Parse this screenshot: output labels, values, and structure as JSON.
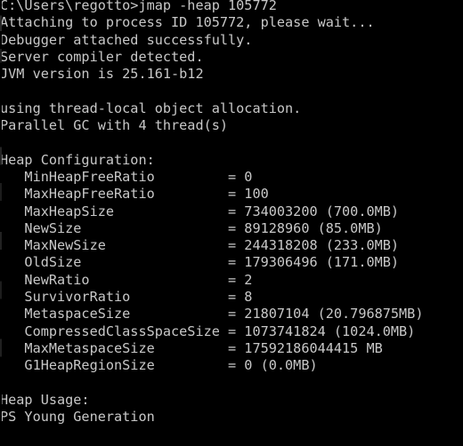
{
  "window": {
    "title": "C:\\WINDOWS\\system32\\cmd.exe",
    "background_color": "#000000",
    "foreground_color": "#c8c8c8"
  },
  "terminal": {
    "prompt": "C:\\Users\\regotto>",
    "command": "jmap -heap 105772",
    "cwd": "C:\\Users\\regotto",
    "user": "regotto",
    "process_id": "105772",
    "tool": "jmap",
    "tool_flag": "-heap",
    "lines": [
      "C:\\Users\\regotto>jmap -heap 105772",
      "Attaching to process ID 105772, please wait...",
      "Debugger attached successfully.",
      "Server compiler detected.",
      "JVM version is 25.161-b12",
      "",
      "using thread-local object allocation.",
      "Parallel GC with 4 thread(s)",
      "",
      "Heap Configuration:",
      "   MinHeapFreeRatio         = 0",
      "   MaxHeapFreeRatio         = 100",
      "   MaxHeapSize              = 734003200 (700.0MB)",
      "   NewSize                  = 89128960 (85.0MB)",
      "   MaxNewSize               = 244318208 (233.0MB)",
      "   OldSize                  = 179306496 (171.0MB)",
      "   NewRatio                 = 2",
      "   SurvivorRatio            = 8",
      "   MetaspaceSize            = 21807104 (20.796875MB)",
      "   CompressedClassSpaceSize = 1073741824 (1024.0MB)",
      "   MaxMetaspaceSize         = 17592186044415 MB",
      "   G1HeapRegionSize         = 0 (0.0MB)",
      "",
      "Heap Usage:",
      "PS Young Generation"
    ],
    "messages": {
      "attaching": "Attaching to process ID 105772, please wait...",
      "debugger_attached": "Debugger attached successfully.",
      "compiler_detected": "Server compiler detected.",
      "jvm_version_label": "JVM version is",
      "jvm_version": "25.161-b12",
      "allocation_mode": "using thread-local object allocation.",
      "gc_info": "Parallel GC with 4 thread(s)",
      "gc_name": "Parallel GC",
      "gc_threads": "4"
    },
    "sections": {
      "heap_configuration_header": "Heap Configuration:",
      "heap_usage_header": "Heap Usage:",
      "young_generation_header": "PS Young Generation"
    },
    "heap_configuration": [
      {
        "name": "MinHeapFreeRatio",
        "eq": "=",
        "value": "0",
        "human": ""
      },
      {
        "name": "MaxHeapFreeRatio",
        "eq": "=",
        "value": "100",
        "human": ""
      },
      {
        "name": "MaxHeapSize",
        "eq": "=",
        "value": "734003200",
        "human": "(700.0MB)"
      },
      {
        "name": "NewSize",
        "eq": "=",
        "value": "89128960",
        "human": "(85.0MB)"
      },
      {
        "name": "MaxNewSize",
        "eq": "=",
        "value": "244318208",
        "human": "(233.0MB)"
      },
      {
        "name": "OldSize",
        "eq": "=",
        "value": "179306496",
        "human": "(171.0MB)"
      },
      {
        "name": "NewRatio",
        "eq": "=",
        "value": "2",
        "human": ""
      },
      {
        "name": "SurvivorRatio",
        "eq": "=",
        "value": "8",
        "human": ""
      },
      {
        "name": "MetaspaceSize",
        "eq": "=",
        "value": "21807104",
        "human": "(20.796875MB)"
      },
      {
        "name": "CompressedClassSpaceSize",
        "eq": "=",
        "value": "1073741824",
        "human": "(1024.0MB)"
      },
      {
        "name": "MaxMetaspaceSize",
        "eq": "=",
        "value": "17592186044415",
        "human": "MB"
      },
      {
        "name": "G1HeapRegionSize",
        "eq": "=",
        "value": "0",
        "human": "(0.0MB)"
      }
    ]
  }
}
